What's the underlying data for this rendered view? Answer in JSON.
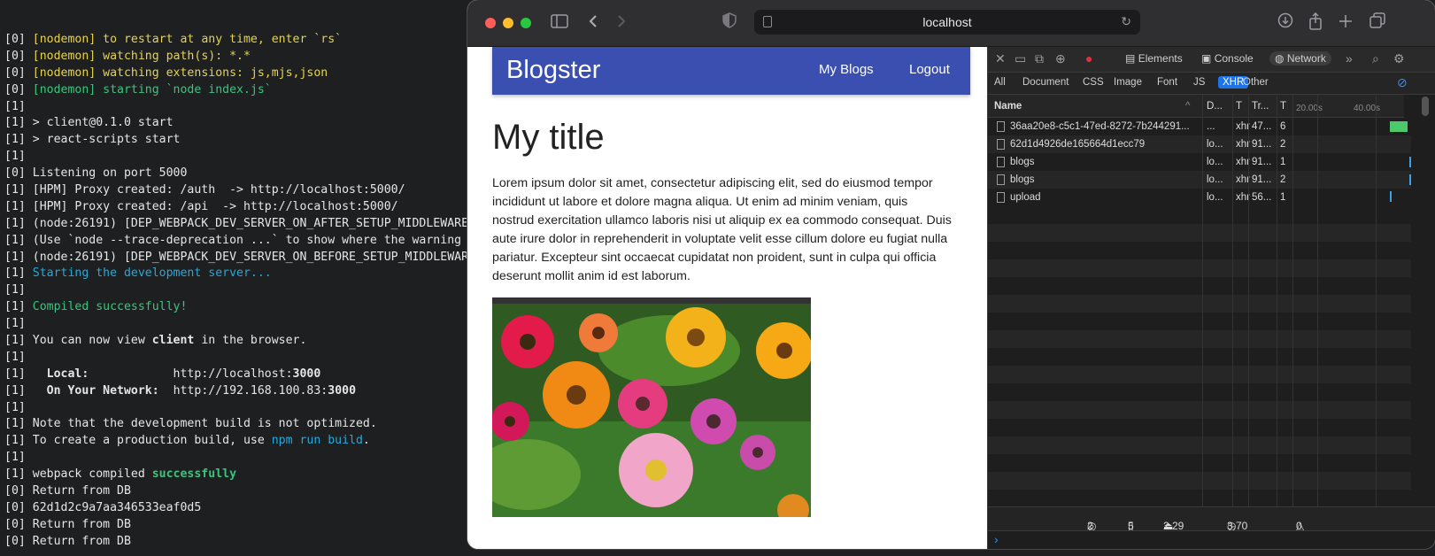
{
  "terminal": {
    "lines": [
      [
        {
          "t": "[0] ",
          "c": ""
        },
        {
          "t": "[nodemon] to restart at any time, enter `rs`",
          "c": "y"
        }
      ],
      [
        {
          "t": "[0] ",
          "c": ""
        },
        {
          "t": "[nodemon] watching path(s): *.*",
          "c": "y"
        }
      ],
      [
        {
          "t": "[0] ",
          "c": ""
        },
        {
          "t": "[nodemon] watching extensions: js,mjs,json",
          "c": "y"
        }
      ],
      [
        {
          "t": "[0] ",
          "c": ""
        },
        {
          "t": "[nodemon] starting `node index.js`",
          "c": "g"
        }
      ],
      [
        {
          "t": "[1]",
          "c": ""
        }
      ],
      [
        {
          "t": "[1] > client@0.1.0 start",
          "c": ""
        }
      ],
      [
        {
          "t": "[1] > react-scripts start",
          "c": ""
        }
      ],
      [
        {
          "t": "[1]",
          "c": ""
        }
      ],
      [
        {
          "t": "[0] Listening on port 5000",
          "c": ""
        }
      ],
      [
        {
          "t": "[1] [HPM] Proxy created: /auth  -> http://localhost:5000/",
          "c": ""
        }
      ],
      [
        {
          "t": "[1] [HPM] Proxy created: /api  -> http://localhost:5000/",
          "c": ""
        }
      ],
      [
        {
          "t": "[1] (node:26191) [DEP_WEBPACK_DEV_SERVER_ON_AFTER_SETUP_MIDDLEWARE",
          "c": ""
        }
      ],
      [
        {
          "t": "[1] (Use `node --trace-deprecation ...` to show where the warning",
          "c": ""
        }
      ],
      [
        {
          "t": "[1] (node:26191) [DEP_WEBPACK_DEV_SERVER_ON_BEFORE_SETUP_MIDDLEWAR",
          "c": ""
        }
      ],
      [
        {
          "t": "[1] ",
          "c": ""
        },
        {
          "t": "Starting the development server...",
          "c": "c"
        }
      ],
      [
        {
          "t": "[1]",
          "c": ""
        }
      ],
      [
        {
          "t": "[1] ",
          "c": ""
        },
        {
          "t": "Compiled successfully!",
          "c": "g"
        }
      ],
      [
        {
          "t": "[1]",
          "c": ""
        }
      ],
      [
        {
          "t": "[1] You can now view ",
          "c": ""
        },
        {
          "t": "client",
          "c": "b"
        },
        {
          "t": " in the browser.",
          "c": ""
        }
      ],
      [
        {
          "t": "[1]",
          "c": ""
        }
      ],
      [
        {
          "t": "[1]   ",
          "c": ""
        },
        {
          "t": "Local:",
          "c": "b"
        },
        {
          "t": "            http://localhost:",
          "c": ""
        },
        {
          "t": "3000",
          "c": "b"
        }
      ],
      [
        {
          "t": "[1]   ",
          "c": ""
        },
        {
          "t": "On Your Network:",
          "c": "b"
        },
        {
          "t": "  http://192.168.100.83:",
          "c": ""
        },
        {
          "t": "3000",
          "c": "b"
        }
      ],
      [
        {
          "t": "[1]",
          "c": ""
        }
      ],
      [
        {
          "t": "[1] Note that the development build is not optimized.",
          "c": ""
        }
      ],
      [
        {
          "t": "[1] To create a production build, use ",
          "c": ""
        },
        {
          "t": "npm run build",
          "c": "c"
        },
        {
          "t": ".",
          "c": ""
        }
      ],
      [
        {
          "t": "[1]",
          "c": ""
        }
      ],
      [
        {
          "t": "[1] webpack compiled ",
          "c": ""
        },
        {
          "t": "successfully",
          "c": "gb"
        }
      ],
      [
        {
          "t": "[0] Return from DB",
          "c": ""
        }
      ],
      [
        {
          "t": "[0] 62d1d2c9a7aa346533eaf0d5",
          "c": ""
        }
      ],
      [
        {
          "t": "[0] Return from DB",
          "c": ""
        }
      ],
      [
        {
          "t": "[0] Return from DB",
          "c": ""
        }
      ]
    ]
  },
  "browser": {
    "url": "localhost",
    "icons": [
      "sidebar-icon",
      "back-icon",
      "forward-icon",
      "shield-icon",
      "download-icon",
      "share-icon",
      "new-tab-icon",
      "tab-overview-icon"
    ]
  },
  "page": {
    "brand": "Blogster",
    "nav": {
      "my_blogs": "My Blogs",
      "logout": "Logout"
    },
    "title": "My title",
    "body": "Lorem ipsum dolor sit amet, consectetur adipiscing elit, sed do eiusmod tempor incididunt ut labore et dolore magna aliqua. Ut enim ad minim veniam, quis nostrud exercitation ullamco laboris nisi ut aliquip ex ea commodo consequat. Duis aute irure dolor in reprehenderit in voluptate velit esse cillum dolore eu fugiat nulla pariatur. Excepteur sint occaecat cupidatat non proident, sunt in culpa qui officia deserunt mollit anim id est laborum."
  },
  "devtools": {
    "tabs": {
      "elements": "Elements",
      "console": "Console",
      "network": "Network"
    },
    "filters": [
      "All",
      "Document",
      "CSS",
      "Image",
      "Font",
      "JS",
      "XHR",
      "Other"
    ],
    "active_filter": "XHR",
    "columns": {
      "name": "Name",
      "domain": "D...",
      "type": "T",
      "transferred": "Tr...",
      "time": "T"
    },
    "timeline_ticks": [
      "20.00s",
      "40.00s"
    ],
    "requests": [
      {
        "name": "36aa20e8-c5c1-47ed-8272-7b244291...",
        "domain": "...",
        "type": "xhr",
        "transferred": "47...",
        "time": "6"
      },
      {
        "name": "62d1d4926de165664d1ecc79",
        "domain": "lo...",
        "type": "xhr",
        "transferred": "91...",
        "time": "2"
      },
      {
        "name": "blogs",
        "domain": "lo...",
        "type": "xhr",
        "transferred": "91...",
        "time": "1"
      },
      {
        "name": "blogs",
        "domain": "lo...",
        "type": "xhr",
        "transferred": "91...",
        "time": "2"
      },
      {
        "name": "upload",
        "domain": "lo...",
        "type": "xhr",
        "transferred": "56...",
        "time": "1"
      }
    ],
    "summary": {
      "domains": "2",
      "requests": "5",
      "transferred": "2.29 KB",
      "resources": "3.70 KB",
      "errors": "0"
    },
    "colors": {
      "accent": "#1d73e8",
      "waterfall_green": "#4cc96a",
      "waterfall_blue": "#3aa0e8"
    }
  }
}
